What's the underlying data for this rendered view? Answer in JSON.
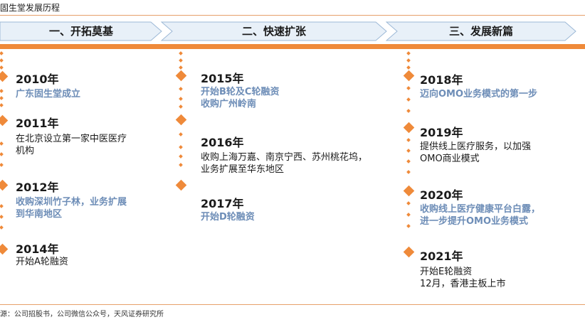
{
  "header": {
    "title": "固生堂发展历程"
  },
  "phases": [
    {
      "label": "一、开拓莫基"
    },
    {
      "label": "二、快速扩张"
    },
    {
      "label": "三、发展新篇"
    }
  ],
  "columns": [
    {
      "events": [
        {
          "year": "2010年",
          "lines": [
            "广东固生堂成立"
          ],
          "style": "blue"
        },
        {
          "year": "2011年",
          "lines": [
            "在北京设立第一家中医医疗",
            "机构"
          ],
          "style": "black"
        },
        {
          "year": "2012年",
          "lines": [
            "收购深圳竹子林，业务扩展",
            "到华南地区"
          ],
          "style": "blue"
        },
        {
          "year": "2014年",
          "lines": [
            "开始A轮融资"
          ],
          "style": "black"
        }
      ]
    },
    {
      "events": [
        {
          "year": "2015年",
          "lines": [
            "开始B轮及C轮融资",
            "收购广州岭南"
          ],
          "style": "blue"
        },
        {
          "year": "2016年",
          "lines": [
            "收购上海万嘉、南京宁西、苏州桃花坞，",
            "业务扩展至华东地区"
          ],
          "style": "black"
        },
        {
          "year": "2017年",
          "lines": [
            "开始D轮融资"
          ],
          "style": "blue"
        }
      ]
    },
    {
      "events": [
        {
          "year": "2018年",
          "lines": [
            "迈向OMO业务模式的第一步"
          ],
          "style": "blue"
        },
        {
          "year": "2019年",
          "lines": [
            "提供线上医疗服务，以加强",
            "OMO商业模式"
          ],
          "style": "black"
        },
        {
          "year": "2020年",
          "lines": [
            "收购线上医疗健康平台白露，",
            "进一步提升OMO业务模式"
          ],
          "style": "blue"
        },
        {
          "year": "2021年",
          "lines": [
            "开始E轮融资",
            "12月，香港主板上市"
          ],
          "style": "black"
        }
      ]
    }
  ],
  "source": "源：公司招股书，公司微信公众号，天风证券研究所",
  "colors": {
    "accent": "#ef8a3a",
    "chevron_fill": "#e8f0f8",
    "chevron_stroke": "#9cb8d6",
    "highlight_text": "#6d8db7"
  }
}
